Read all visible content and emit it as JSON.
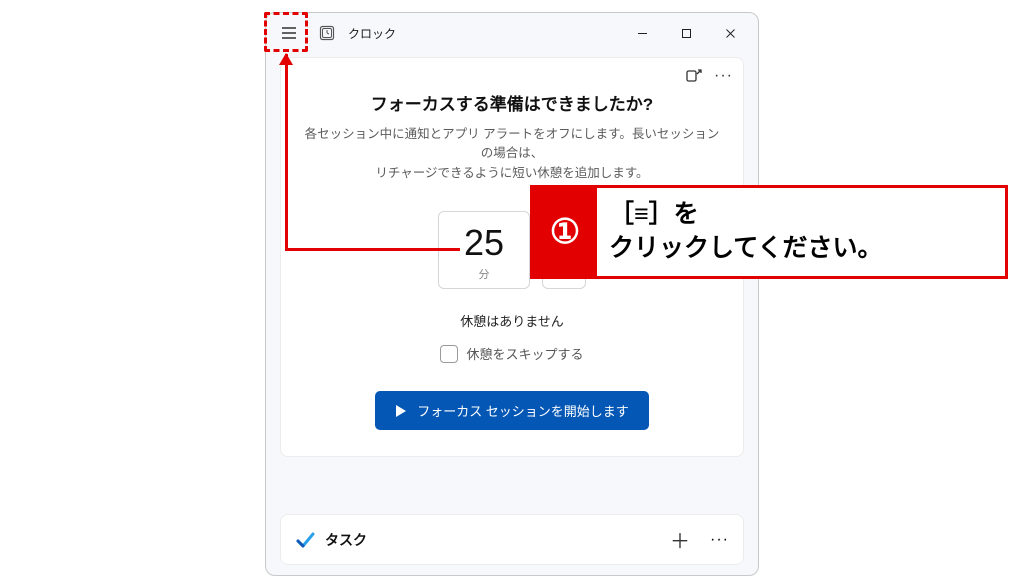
{
  "titlebar": {
    "app_name": "クロック"
  },
  "focus_card": {
    "heading": "フォーカスする準備はできましたか?",
    "description_line1": "各セッション中に通知とアプリ アラートをオフにします。長いセッションの場合は、",
    "description_line2": "リチャージできるように短い休憩を追加します。",
    "timer_value": "25",
    "timer_unit": "分",
    "no_break": "休憩はありません",
    "skip_break_label": "休憩をスキップする",
    "start_button": "フォーカス セッションを開始します"
  },
  "task_section": {
    "label": "タスク"
  },
  "annotation": {
    "step_number": "①",
    "text": "［≡］を\nクリックしてください。"
  }
}
